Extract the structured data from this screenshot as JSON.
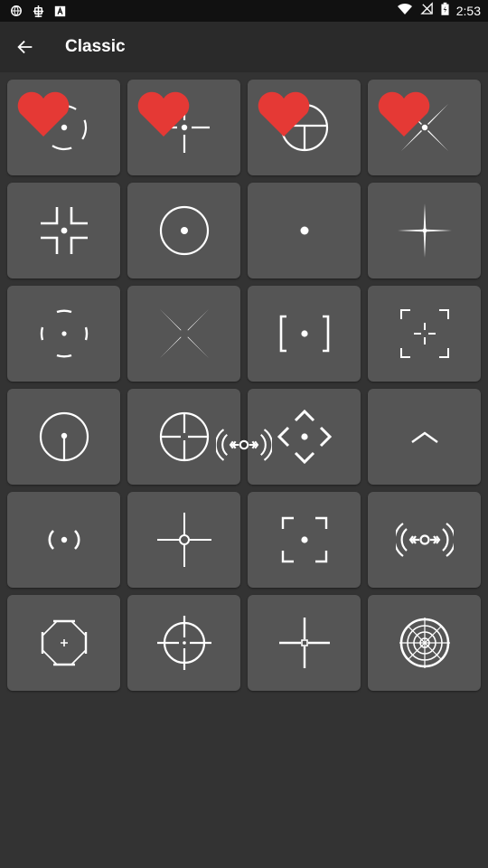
{
  "status_bar": {
    "time": "2:53",
    "icons": [
      "vpn-icon",
      "bug-icon",
      "text-icon",
      "wifi-icon",
      "signal-off-icon",
      "battery-charging-icon"
    ]
  },
  "app_bar": {
    "back_icon": "arrow-back-icon",
    "title": "Classic"
  },
  "colors": {
    "background": "#333333",
    "tile": "#555555",
    "app_bar": "#2a2a2a",
    "status_bar": "#111111",
    "favorite": "#e53935",
    "crosshair": "#ffffff"
  },
  "crosshairs": [
    {
      "icon": "crosshair-dashed-circle-dot-icon",
      "favorite": true
    },
    {
      "icon": "crosshair-gap-cross-dot-icon",
      "favorite": true
    },
    {
      "icon": "crosshair-circle-t-icon",
      "favorite": true
    },
    {
      "icon": "crosshair-x-blades-icon",
      "favorite": true
    },
    {
      "icon": "crosshair-corner-brackets-icon",
      "favorite": false
    },
    {
      "icon": "crosshair-circle-dot-icon",
      "favorite": false
    },
    {
      "icon": "crosshair-dot-icon",
      "favorite": false
    },
    {
      "icon": "crosshair-thin-star-icon",
      "favorite": false
    },
    {
      "icon": "crosshair-broken-circle-dot-icon",
      "favorite": false
    },
    {
      "icon": "crosshair-x-spikes-icon",
      "favorite": false
    },
    {
      "icon": "crosshair-square-brackets-dot-icon",
      "favorite": false
    },
    {
      "icon": "crosshair-corner-frame-plus-icon",
      "favorite": false
    },
    {
      "icon": "crosshair-circle-stem-icon",
      "favorite": false
    },
    {
      "icon": "crosshair-circle-cross-icon",
      "favorite": false
    },
    {
      "icon": "crosshair-diamond-arrows-icon",
      "favorite": false
    },
    {
      "icon": "crosshair-caret-up-icon",
      "favorite": false
    },
    {
      "icon": "crosshair-parens-dot-icon",
      "favorite": false
    },
    {
      "icon": "crosshair-cross-small-circle-icon",
      "favorite": false
    },
    {
      "icon": "crosshair-frame-dot-icon",
      "favorite": false
    },
    {
      "icon": "crosshair-bracket-ring-icon",
      "favorite": false
    },
    {
      "icon": "crosshair-octagon-plus-icon",
      "favorite": false
    },
    {
      "icon": "crosshair-circle-cross-long-icon",
      "favorite": false
    },
    {
      "icon": "crosshair-cross-square-icon",
      "favorite": false
    },
    {
      "icon": "crosshair-sniper-scope-icon",
      "favorite": false
    }
  ],
  "dragged_item": {
    "icon": "crosshair-bracket-ring-icon"
  }
}
